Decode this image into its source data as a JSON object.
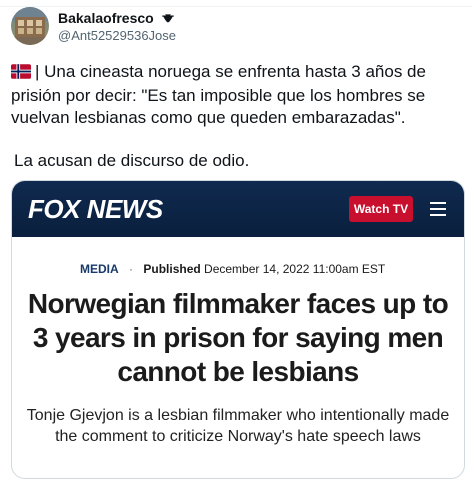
{
  "tweet": {
    "author": {
      "display_name": "Bakalaofresco",
      "handle": "@Ant52529536Jose",
      "verified_icon": "twitter-verified-icon"
    },
    "flag_icon": "norway-flag-icon",
    "text": "| Una cineasta noruega se enfrenta hasta 3 años de prisión por decir: \"Es tan imposible que los hombres se vuelvan lesbianas como que queden embarazadas\".",
    "text2": "La acusan de discurso de odio."
  },
  "card": {
    "brand": "FOX NEWS",
    "watch_label": "Watch TV",
    "category": "MEDIA",
    "published_label": "Published",
    "published_date": "December 14, 2022 11:00am EST",
    "headline": "Norwegian filmmaker faces up to 3 years in prison for saying men cannot be lesbians",
    "subhead": "Tonje Gjevjon is a lesbian filmmaker who intentionally made the comment to criticize Norway's hate speech laws"
  },
  "colors": {
    "fox_navy": "#0f2a4f",
    "watch_red": "#c8102e",
    "twitter_blue": "#1d9bf0",
    "text_primary": "#0f1419",
    "text_secondary": "#536471"
  }
}
